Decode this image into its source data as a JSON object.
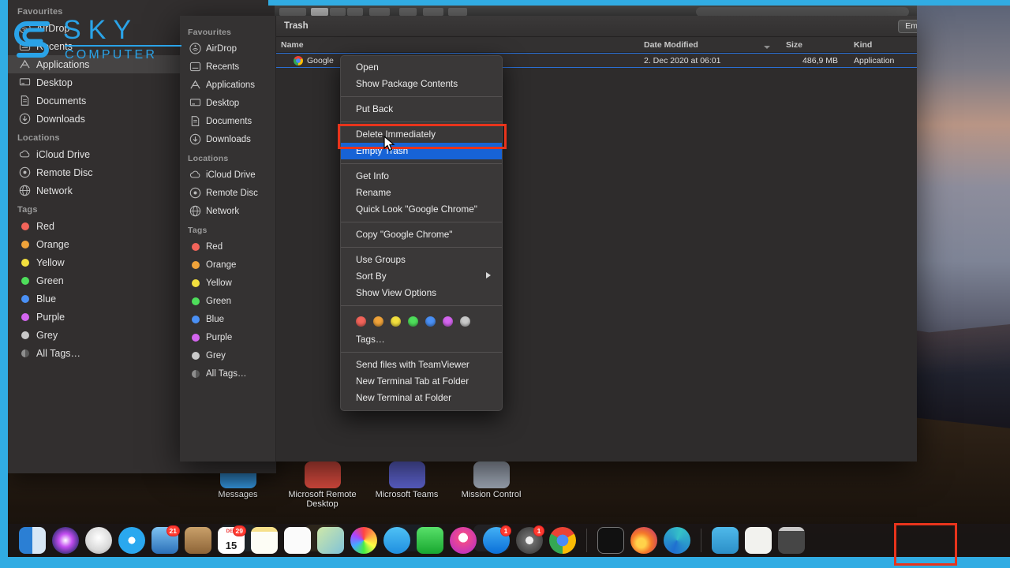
{
  "theme": {
    "accent_blue": "#31ace3",
    "menu_highlight": "#1763d6",
    "annotation_red": "#e8341c",
    "selection_outline": "#2b6fd4"
  },
  "watermark": {
    "line1": "SKY",
    "line2": "COMPUTER"
  },
  "background_sidebar": {
    "sections": [
      {
        "title": "Favourites",
        "items": [
          {
            "label": "AirDrop",
            "icon": "airdrop-icon"
          },
          {
            "label": "Recents",
            "icon": "recents-icon"
          },
          {
            "label": "Applications",
            "icon": "applications-icon",
            "selected": true
          },
          {
            "label": "Desktop",
            "icon": "desktop-icon"
          },
          {
            "label": "Documents",
            "icon": "documents-icon"
          },
          {
            "label": "Downloads",
            "icon": "downloads-icon"
          }
        ]
      },
      {
        "title": "Locations",
        "items": [
          {
            "label": "iCloud Drive",
            "icon": "icloud-icon"
          },
          {
            "label": "Remote Disc",
            "icon": "disc-icon"
          },
          {
            "label": "Network",
            "icon": "network-icon"
          }
        ]
      },
      {
        "title": "Tags",
        "items": [
          {
            "label": "Red",
            "icon": "tag-dot-icon",
            "color": "#f2645a"
          },
          {
            "label": "Orange",
            "icon": "tag-dot-icon",
            "color": "#f0a33a"
          },
          {
            "label": "Yellow",
            "icon": "tag-dot-icon",
            "color": "#f2df3e"
          },
          {
            "label": "Green",
            "icon": "tag-dot-icon",
            "color": "#4ede5b"
          },
          {
            "label": "Blue",
            "icon": "tag-dot-icon",
            "color": "#4a90f5"
          },
          {
            "label": "Purple",
            "icon": "tag-dot-icon",
            "color": "#d465ef"
          },
          {
            "label": "Grey",
            "icon": "tag-dot-icon",
            "color": "#c9c9c9"
          },
          {
            "label": "All Tags…",
            "icon": "all-tags-icon",
            "color": "#8e8e8e"
          }
        ]
      }
    ]
  },
  "finder": {
    "title": "Trash",
    "empty_button": "Empty",
    "columns": [
      "Name",
      "Date Modified",
      "Size",
      "Kind"
    ],
    "sort_column": "Date Modified",
    "rows": [
      {
        "name": "Google",
        "icon": "chrome-icon",
        "date_modified": "2. Dec 2020 at 06:01",
        "size": "486,9 MB",
        "kind": "Application",
        "selected": true
      }
    ],
    "sidebar": {
      "sections": [
        {
          "title": "Favourites",
          "items": [
            {
              "label": "AirDrop",
              "icon": "airdrop-icon"
            },
            {
              "label": "Recents",
              "icon": "recents-icon"
            },
            {
              "label": "Applications",
              "icon": "applications-icon"
            },
            {
              "label": "Desktop",
              "icon": "desktop-icon"
            },
            {
              "label": "Documents",
              "icon": "documents-icon"
            },
            {
              "label": "Downloads",
              "icon": "downloads-icon"
            }
          ]
        },
        {
          "title": "Locations",
          "items": [
            {
              "label": "iCloud Drive",
              "icon": "icloud-icon"
            },
            {
              "label": "Remote Disc",
              "icon": "disc-icon"
            },
            {
              "label": "Network",
              "icon": "network-icon"
            }
          ]
        },
        {
          "title": "Tags",
          "items": [
            {
              "label": "Red",
              "icon": "tag-dot-icon",
              "color": "#f2645a"
            },
            {
              "label": "Orange",
              "icon": "tag-dot-icon",
              "color": "#f0a33a"
            },
            {
              "label": "Yellow",
              "icon": "tag-dot-icon",
              "color": "#f2df3e"
            },
            {
              "label": "Green",
              "icon": "tag-dot-icon",
              "color": "#4ede5b"
            },
            {
              "label": "Blue",
              "icon": "tag-dot-icon",
              "color": "#4a90f5"
            },
            {
              "label": "Purple",
              "icon": "tag-dot-icon",
              "color": "#d465ef"
            },
            {
              "label": "Grey",
              "icon": "tag-dot-icon",
              "color": "#c9c9c9"
            },
            {
              "label": "All Tags…",
              "icon": "all-tags-icon",
              "color": "#8e8e8e"
            }
          ]
        }
      ]
    }
  },
  "context_menu": {
    "groups": [
      {
        "items": [
          {
            "label": "Open"
          },
          {
            "label": "Show Package Contents"
          }
        ]
      },
      {
        "items": [
          {
            "label": "Put Back"
          }
        ]
      },
      {
        "items": [
          {
            "label": "Delete Immediately"
          },
          {
            "label": "Empty Trash",
            "highlighted": true
          }
        ]
      },
      {
        "items": [
          {
            "label": "Get Info"
          },
          {
            "label": "Rename"
          },
          {
            "label": "Quick Look \"Google Chrome\""
          }
        ]
      },
      {
        "items": [
          {
            "label": "Copy \"Google Chrome\""
          }
        ]
      },
      {
        "items": [
          {
            "label": "Use Groups"
          },
          {
            "label": "Sort By",
            "submenu": true
          },
          {
            "label": "Show View Options"
          }
        ]
      },
      {
        "tags": [
          "#f2645a",
          "#f0a33a",
          "#f2df3e",
          "#4ede5b",
          "#4a90f5",
          "#d465ef",
          "#c9c9c9"
        ],
        "items": [
          {
            "label": "Tags…"
          }
        ]
      },
      {
        "items": [
          {
            "label": "Send files with TeamViewer"
          },
          {
            "label": "New Terminal Tab at Folder"
          },
          {
            "label": "New Terminal at Folder"
          }
        ]
      }
    ]
  },
  "desktop_apps": [
    {
      "label": "Messages",
      "icon": "messages-icon",
      "color": "#3aa3f2"
    },
    {
      "label": "Microsoft Remote Desktop",
      "icon": "rdp-icon",
      "color": "#d0483c"
    },
    {
      "label": "Microsoft Teams",
      "icon": "teams-icon",
      "color": "#5a5fc6"
    },
    {
      "label": "Mission Control",
      "icon": "mission-control-icon",
      "color": "#9aa3b0"
    }
  ],
  "desktop_apps_row2": [
    {
      "label": "",
      "icon": "folder-icon",
      "color": "#49b7e8"
    },
    {
      "label": "",
      "icon": "stickies-icon",
      "color": "#f4d95c"
    },
    {
      "label": "",
      "icon": "mail-icon",
      "color": "#1e86d8"
    },
    {
      "label": "",
      "icon": "preview-icon",
      "color": "#7f9fc4"
    }
  ],
  "dock": {
    "items": [
      {
        "name": "finder-icon",
        "badge": ""
      },
      {
        "name": "siri-icon",
        "badge": ""
      },
      {
        "name": "launchpad-icon",
        "badge": ""
      },
      {
        "name": "safari-icon",
        "badge": ""
      },
      {
        "name": "mail-icon",
        "badge": "21"
      },
      {
        "name": "contacts-icon",
        "badge": ""
      },
      {
        "name": "calendar-icon",
        "badge": "29"
      },
      {
        "name": "notes-icon",
        "badge": ""
      },
      {
        "name": "reminders-icon",
        "badge": ""
      },
      {
        "name": "maps-icon",
        "badge": ""
      },
      {
        "name": "photos-icon",
        "badge": ""
      },
      {
        "name": "messages-icon",
        "badge": ""
      },
      {
        "name": "facetime-icon",
        "badge": ""
      },
      {
        "name": "itunes-icon",
        "badge": ""
      },
      {
        "name": "app-store-icon",
        "badge": "1"
      },
      {
        "name": "system-preferences-icon",
        "badge": "1"
      },
      {
        "name": "chrome-icon",
        "badge": ""
      },
      {
        "name": "terminal-icon",
        "badge": ""
      },
      {
        "name": "firefox-icon",
        "badge": ""
      },
      {
        "name": "edge-icon",
        "badge": ""
      },
      {
        "name": "downloads-stack-icon",
        "badge": ""
      },
      {
        "name": "documents-stack-icon",
        "badge": ""
      },
      {
        "name": "trash-icon",
        "badge": ""
      }
    ],
    "calendar_day": "15"
  }
}
